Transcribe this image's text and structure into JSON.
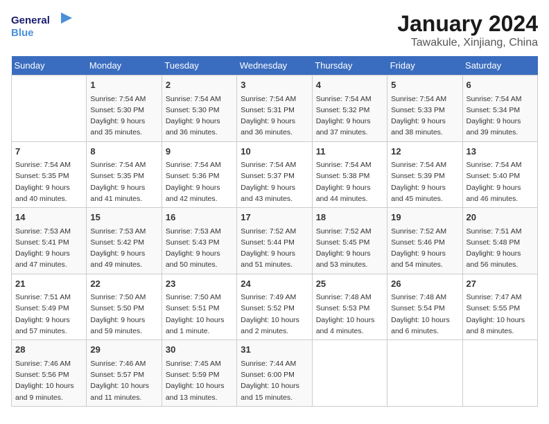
{
  "logo": {
    "text_general": "General",
    "text_blue": "Blue"
  },
  "title": "January 2024",
  "subtitle": "Tawakule, Xinjiang, China",
  "days_of_week": [
    "Sunday",
    "Monday",
    "Tuesday",
    "Wednesday",
    "Thursday",
    "Friday",
    "Saturday"
  ],
  "weeks": [
    [
      {
        "day": "",
        "content": ""
      },
      {
        "day": "1",
        "content": "Sunrise: 7:54 AM\nSunset: 5:30 PM\nDaylight: 9 hours\nand 35 minutes."
      },
      {
        "day": "2",
        "content": "Sunrise: 7:54 AM\nSunset: 5:30 PM\nDaylight: 9 hours\nand 36 minutes."
      },
      {
        "day": "3",
        "content": "Sunrise: 7:54 AM\nSunset: 5:31 PM\nDaylight: 9 hours\nand 36 minutes."
      },
      {
        "day": "4",
        "content": "Sunrise: 7:54 AM\nSunset: 5:32 PM\nDaylight: 9 hours\nand 37 minutes."
      },
      {
        "day": "5",
        "content": "Sunrise: 7:54 AM\nSunset: 5:33 PM\nDaylight: 9 hours\nand 38 minutes."
      },
      {
        "day": "6",
        "content": "Sunrise: 7:54 AM\nSunset: 5:34 PM\nDaylight: 9 hours\nand 39 minutes."
      }
    ],
    [
      {
        "day": "7",
        "content": "Sunrise: 7:54 AM\nSunset: 5:35 PM\nDaylight: 9 hours\nand 40 minutes."
      },
      {
        "day": "8",
        "content": "Sunrise: 7:54 AM\nSunset: 5:35 PM\nDaylight: 9 hours\nand 41 minutes."
      },
      {
        "day": "9",
        "content": "Sunrise: 7:54 AM\nSunset: 5:36 PM\nDaylight: 9 hours\nand 42 minutes."
      },
      {
        "day": "10",
        "content": "Sunrise: 7:54 AM\nSunset: 5:37 PM\nDaylight: 9 hours\nand 43 minutes."
      },
      {
        "day": "11",
        "content": "Sunrise: 7:54 AM\nSunset: 5:38 PM\nDaylight: 9 hours\nand 44 minutes."
      },
      {
        "day": "12",
        "content": "Sunrise: 7:54 AM\nSunset: 5:39 PM\nDaylight: 9 hours\nand 45 minutes."
      },
      {
        "day": "13",
        "content": "Sunrise: 7:54 AM\nSunset: 5:40 PM\nDaylight: 9 hours\nand 46 minutes."
      }
    ],
    [
      {
        "day": "14",
        "content": "Sunrise: 7:53 AM\nSunset: 5:41 PM\nDaylight: 9 hours\nand 47 minutes."
      },
      {
        "day": "15",
        "content": "Sunrise: 7:53 AM\nSunset: 5:42 PM\nDaylight: 9 hours\nand 49 minutes."
      },
      {
        "day": "16",
        "content": "Sunrise: 7:53 AM\nSunset: 5:43 PM\nDaylight: 9 hours\nand 50 minutes."
      },
      {
        "day": "17",
        "content": "Sunrise: 7:52 AM\nSunset: 5:44 PM\nDaylight: 9 hours\nand 51 minutes."
      },
      {
        "day": "18",
        "content": "Sunrise: 7:52 AM\nSunset: 5:45 PM\nDaylight: 9 hours\nand 53 minutes."
      },
      {
        "day": "19",
        "content": "Sunrise: 7:52 AM\nSunset: 5:46 PM\nDaylight: 9 hours\nand 54 minutes."
      },
      {
        "day": "20",
        "content": "Sunrise: 7:51 AM\nSunset: 5:48 PM\nDaylight: 9 hours\nand 56 minutes."
      }
    ],
    [
      {
        "day": "21",
        "content": "Sunrise: 7:51 AM\nSunset: 5:49 PM\nDaylight: 9 hours\nand 57 minutes."
      },
      {
        "day": "22",
        "content": "Sunrise: 7:50 AM\nSunset: 5:50 PM\nDaylight: 9 hours\nand 59 minutes."
      },
      {
        "day": "23",
        "content": "Sunrise: 7:50 AM\nSunset: 5:51 PM\nDaylight: 10 hours\nand 1 minute."
      },
      {
        "day": "24",
        "content": "Sunrise: 7:49 AM\nSunset: 5:52 PM\nDaylight: 10 hours\nand 2 minutes."
      },
      {
        "day": "25",
        "content": "Sunrise: 7:48 AM\nSunset: 5:53 PM\nDaylight: 10 hours\nand 4 minutes."
      },
      {
        "day": "26",
        "content": "Sunrise: 7:48 AM\nSunset: 5:54 PM\nDaylight: 10 hours\nand 6 minutes."
      },
      {
        "day": "27",
        "content": "Sunrise: 7:47 AM\nSunset: 5:55 PM\nDaylight: 10 hours\nand 8 minutes."
      }
    ],
    [
      {
        "day": "28",
        "content": "Sunrise: 7:46 AM\nSunset: 5:56 PM\nDaylight: 10 hours\nand 9 minutes."
      },
      {
        "day": "29",
        "content": "Sunrise: 7:46 AM\nSunset: 5:57 PM\nDaylight: 10 hours\nand 11 minutes."
      },
      {
        "day": "30",
        "content": "Sunrise: 7:45 AM\nSunset: 5:59 PM\nDaylight: 10 hours\nand 13 minutes."
      },
      {
        "day": "31",
        "content": "Sunrise: 7:44 AM\nSunset: 6:00 PM\nDaylight: 10 hours\nand 15 minutes."
      },
      {
        "day": "",
        "content": ""
      },
      {
        "day": "",
        "content": ""
      },
      {
        "day": "",
        "content": ""
      }
    ]
  ]
}
